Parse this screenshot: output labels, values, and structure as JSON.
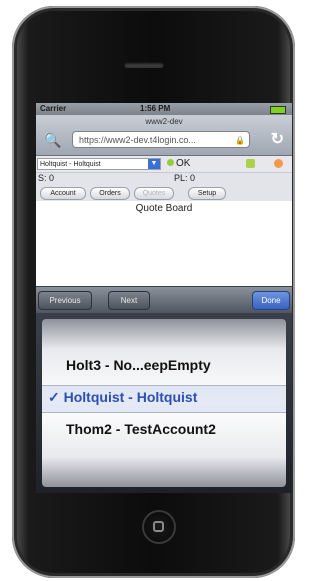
{
  "status_bar": {
    "carrier": "Carrier",
    "time": "1:56 PM"
  },
  "safari": {
    "page_title": "www2-dev",
    "url": "https://www2-dev.t4login.co..."
  },
  "app": {
    "account_select": "Holtquist - Holtquist",
    "ok_label": "OK",
    "s_label": "S: 0",
    "pl_label": "PL: 0",
    "buttons": {
      "account": "Account",
      "orders": "Orders",
      "disabled": "Quotes",
      "setup": "Setup"
    },
    "quote_board": "Quote Board"
  },
  "accessory": {
    "previous": "Previous",
    "next": "Next",
    "done": "Done"
  },
  "picker": {
    "items": [
      "Holt3 - No...eepEmpty",
      "Holtquist - Holtquist",
      "Thom2 - TestAccount2"
    ],
    "selected_index": 1,
    "checkmark": "✓"
  },
  "colors": {
    "accent": "#2b4fb3",
    "done_button": "#3a62c0",
    "ok_dot": "#8fcf3a"
  }
}
